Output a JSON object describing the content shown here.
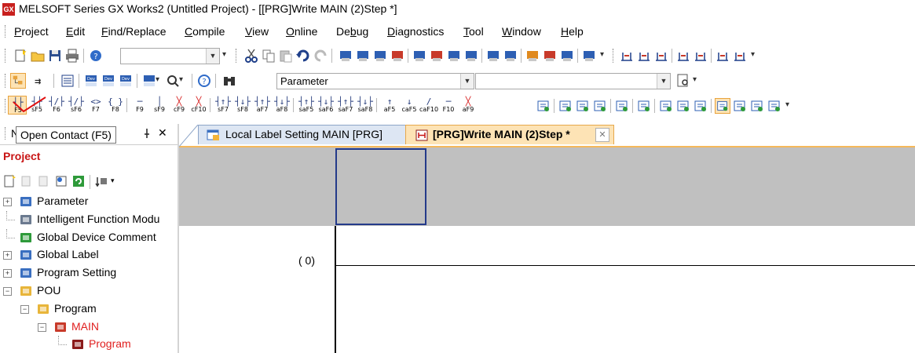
{
  "window": {
    "title": "MELSOFT Series GX Works2 (Untitled Project) - [[PRG]Write MAIN (2)Step *]",
    "app_icon": "GX"
  },
  "menu": {
    "items": [
      {
        "label": "Project",
        "u": "P"
      },
      {
        "label": "Edit",
        "u": "E"
      },
      {
        "label": "Find/Replace",
        "u": "F"
      },
      {
        "label": "Compile",
        "u": "C"
      },
      {
        "label": "View",
        "u": "V"
      },
      {
        "label": "Online",
        "u": "O"
      },
      {
        "label": "Debug",
        "u": "b"
      },
      {
        "label": "Diagnostics",
        "u": "D"
      },
      {
        "label": "Tool",
        "u": "T"
      },
      {
        "label": "Window",
        "u": "W"
      },
      {
        "label": "Help",
        "u": "H"
      }
    ]
  },
  "toolbar2": {
    "find_combo_value": "Parameter",
    "second_combo_value": ""
  },
  "ladder_buttons": [
    {
      "sym": "┤├",
      "key": "F5"
    },
    {
      "sym": "┤├",
      "key": "sF5"
    },
    {
      "sym": "┤/├",
      "key": "F6"
    },
    {
      "sym": "┤/├",
      "key": "sF6"
    },
    {
      "sym": "<>",
      "key": "F7"
    },
    {
      "sym": "{ }",
      "key": "F8"
    },
    {
      "sym": "─",
      "key": "F9"
    },
    {
      "sym": "│",
      "key": "sF9"
    },
    {
      "sym": "╳",
      "key": "cF9"
    },
    {
      "sym": "╳",
      "key": "cF10"
    },
    {
      "sym": "┤↑├",
      "key": "sF7"
    },
    {
      "sym": "┤↓├",
      "key": "sF8"
    },
    {
      "sym": "┤↑├",
      "key": "aF7"
    },
    {
      "sym": "┤↓├",
      "key": "aF8"
    },
    {
      "sym": "┤↑├",
      "key": "saF5"
    },
    {
      "sym": "┤↓├",
      "key": "saF6"
    },
    {
      "sym": "┤↑├",
      "key": "saF7"
    },
    {
      "sym": "┤↓├",
      "key": "saF8"
    },
    {
      "sym": "↑",
      "key": "aF5"
    },
    {
      "sym": "↓",
      "key": "caF5"
    },
    {
      "sym": "/",
      "key": "caF10"
    },
    {
      "sym": "─",
      "key": "F10"
    },
    {
      "sym": "╳",
      "key": "aF9"
    }
  ],
  "navigation": {
    "header_label": "N",
    "pin_icon": "pin-icon",
    "close_label": "✕",
    "tooltip": "Open Contact (F5)",
    "project_label": "Project",
    "tree": [
      {
        "label": "Parameter",
        "indent": 0,
        "expander": "+",
        "icon": "parameter-icon",
        "highlight": false
      },
      {
        "label": "Intelligent Function Modu",
        "indent": 0,
        "expander": "",
        "icon": "intelligent-module-icon",
        "highlight": false
      },
      {
        "label": "Global Device Comment",
        "indent": 0,
        "expander": "",
        "icon": "device-comment-icon",
        "highlight": false
      },
      {
        "label": "Global Label",
        "indent": 0,
        "expander": "+",
        "icon": "global-label-icon",
        "highlight": false
      },
      {
        "label": "Program Setting",
        "indent": 0,
        "expander": "+",
        "icon": "program-setting-icon",
        "highlight": false
      },
      {
        "label": "POU",
        "indent": 0,
        "expander": "−",
        "icon": "pou-folder-icon",
        "highlight": false
      },
      {
        "label": "Program",
        "indent": 1,
        "expander": "−",
        "icon": "program-folder-icon",
        "highlight": false
      },
      {
        "label": "MAIN",
        "indent": 2,
        "expander": "−",
        "icon": "main-program-icon",
        "highlight": true
      },
      {
        "label": "Program",
        "indent": 3,
        "expander": "",
        "icon": "ladder-program-icon",
        "highlight": true
      }
    ]
  },
  "tabs": [
    {
      "label": "Local Label Setting MAIN [PRG]",
      "active": false
    },
    {
      "label": "[PRG]Write MAIN (2)Step *",
      "active": true,
      "close": "✕"
    }
  ],
  "editor": {
    "step_label": "(    0)"
  },
  "colors": {
    "accent_red": "#c81414",
    "cursor": "#243a8a",
    "tab_active": "#fde3b5"
  }
}
